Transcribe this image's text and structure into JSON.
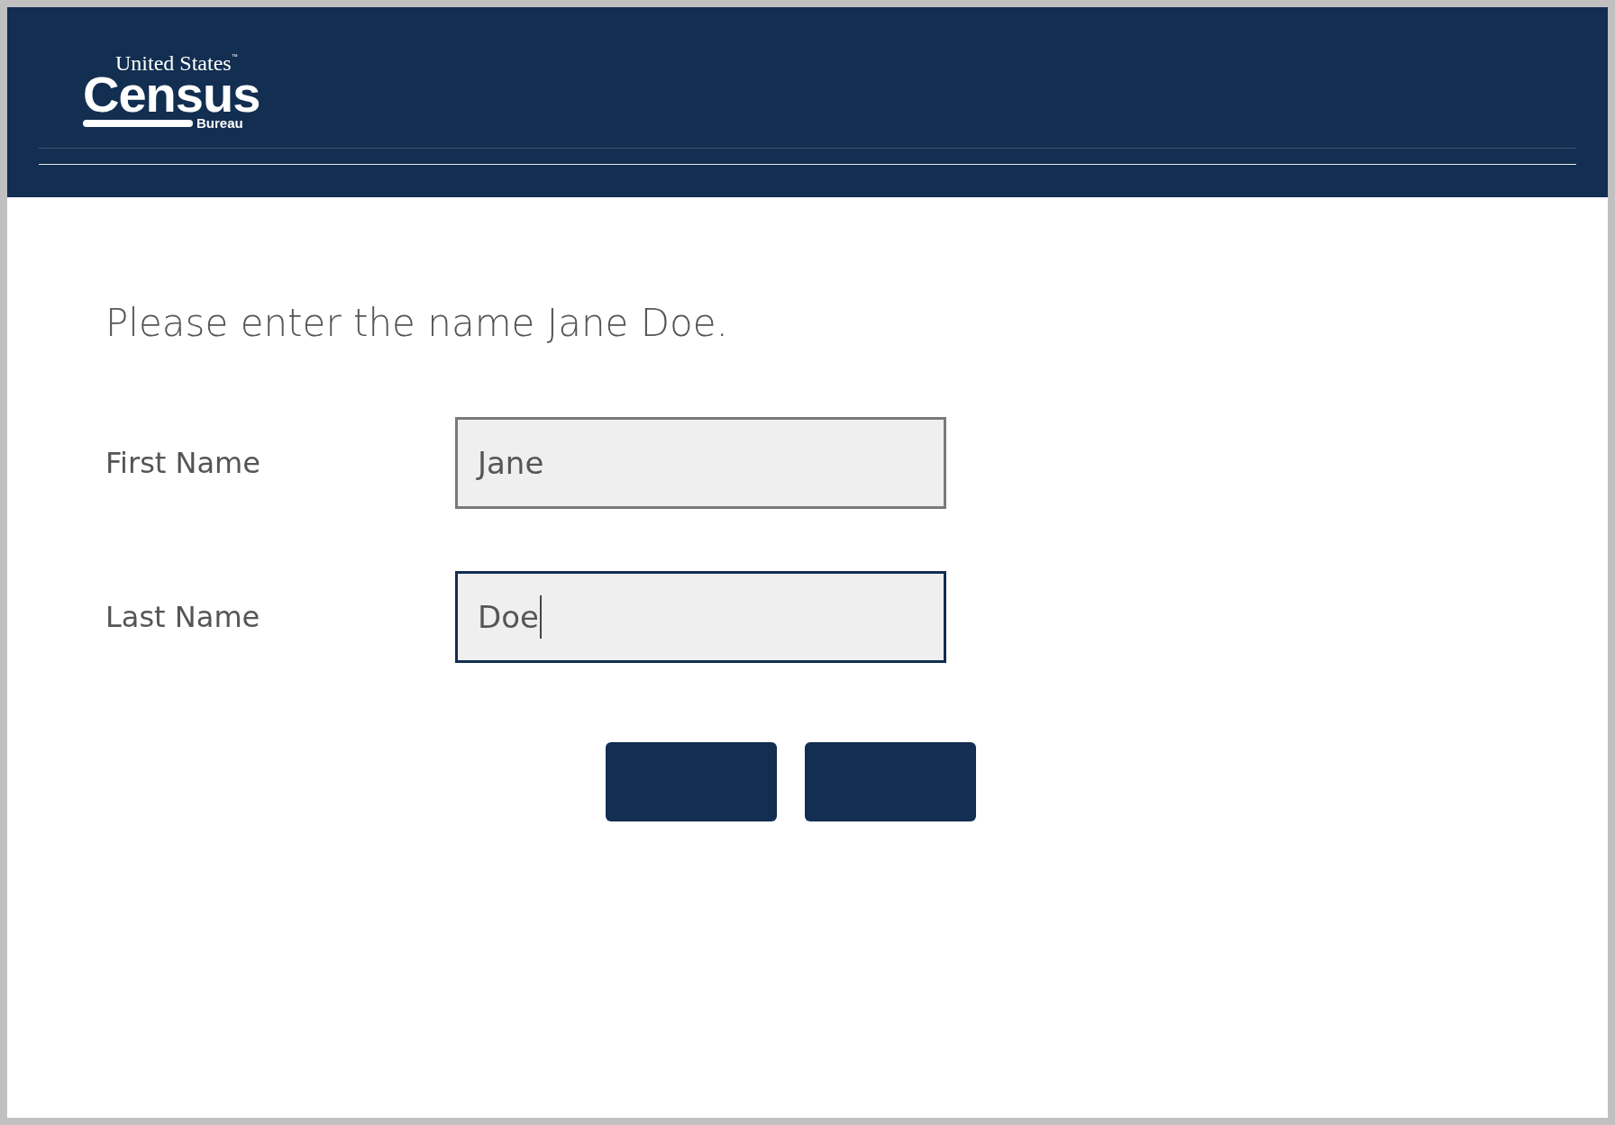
{
  "header": {
    "logo": {
      "top": "United States",
      "trademark": "™",
      "main": "Census",
      "bottom": "Bureau"
    }
  },
  "instruction": "Please enter the name Jane Doe.",
  "fields": [
    {
      "label": "First Name",
      "value": "Jane",
      "focused": false
    },
    {
      "label": "Last Name",
      "value": "Doe",
      "focused": true
    }
  ],
  "buttons": [
    {
      "kind": "primary"
    },
    {
      "kind": "primary"
    }
  ]
}
